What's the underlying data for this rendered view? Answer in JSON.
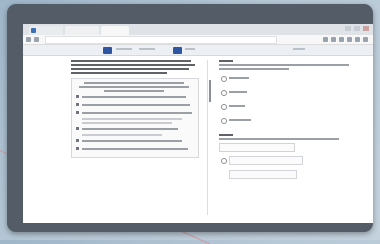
{
  "browser": {
    "tabs": [
      {
        "label": ""
      },
      {
        "label": ""
      },
      {
        "label": ""
      }
    ],
    "address": ""
  },
  "toolbar": {
    "items": [
      {
        "label": ""
      },
      {
        "label": ""
      },
      {
        "label": ""
      }
    ]
  },
  "passage": {
    "title": "",
    "body": "",
    "box_heading": "",
    "list_items": [
      "",
      "",
      "",
      "",
      "",
      ""
    ]
  },
  "question": {
    "number": "",
    "prompt": "",
    "options": [
      "",
      "",
      "",
      ""
    ],
    "second_label": "",
    "fields": [
      "",
      "",
      ""
    ]
  },
  "colors": {
    "accent": "#2f56a3",
    "bezel": "#545c68"
  }
}
